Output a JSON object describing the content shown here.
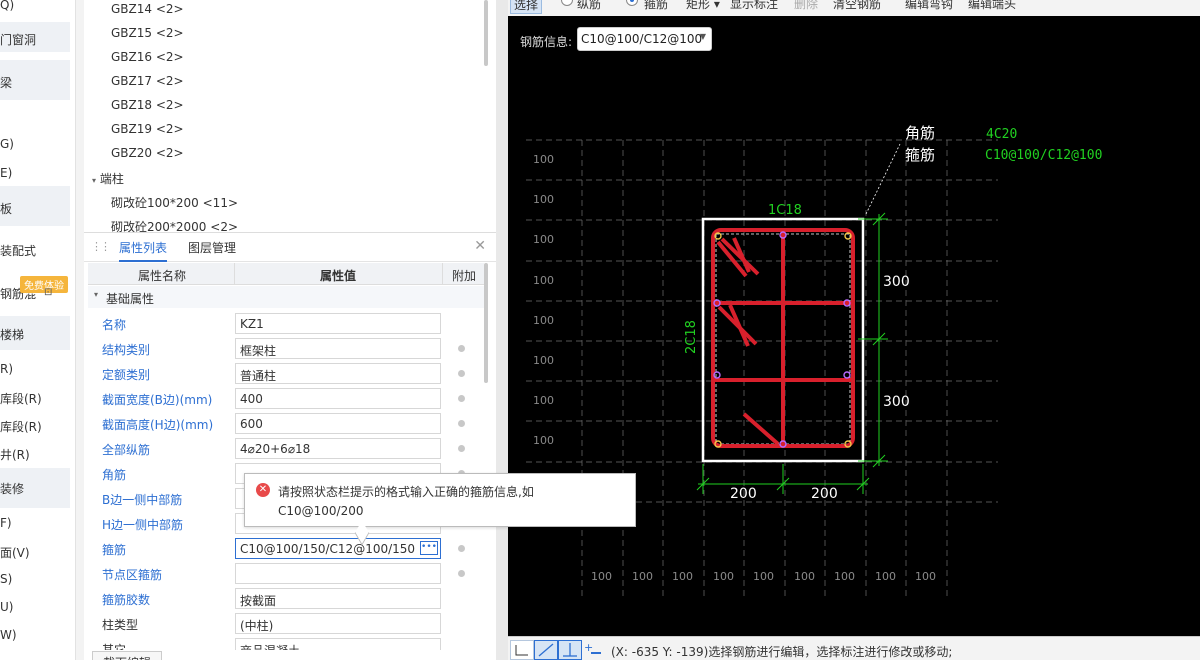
{
  "sidebar": {
    "items": [
      "Q)",
      "门窗洞",
      "梁",
      "G)",
      "E)",
      "板",
      "装配式",
      "钢筋混",
      "楼梯",
      "R)",
      "库段(R)",
      "库段(R)",
      "井(R)",
      "装修",
      "F)",
      "面(V)",
      "S)",
      "U)",
      "W)"
    ],
    "badge": "免费体验"
  },
  "tree": {
    "items": [
      "GBZ14 <2>",
      "GBZ15 <2>",
      "GBZ16 <2>",
      "GBZ17 <2>",
      "GBZ18 <2>",
      "GBZ19 <2>",
      "GBZ20 <2>"
    ],
    "group": "端柱",
    "sub_items": [
      "砌改砼100*200 <11>",
      "砌改砼200*2000 <2>"
    ]
  },
  "prop_panel": {
    "tab_active": "属性列表",
    "tab_other": "图层管理",
    "headers": {
      "name": "属性名称",
      "value": "属性值",
      "extra": "附加"
    },
    "group": "基础属性",
    "rows": [
      {
        "name": "名称",
        "value": "KZ1"
      },
      {
        "name": "结构类别",
        "value": "框架柱"
      },
      {
        "name": "定额类别",
        "value": "普通柱"
      },
      {
        "name": "截面宽度(B边)(mm)",
        "value": "400"
      },
      {
        "name": "截面高度(H边)(mm)",
        "value": "600"
      },
      {
        "name": "全部纵筋",
        "value": "4⌀20+6⌀18"
      },
      {
        "name": "角筋",
        "value": ""
      },
      {
        "name": "B边一侧中部筋",
        "value": ""
      },
      {
        "name": "H边一侧中部筋",
        "value": ""
      },
      {
        "name": "箍筋",
        "value": "C10@100/150/C12@100/150"
      },
      {
        "name": "节点区箍筋",
        "value": ""
      },
      {
        "name": "箍筋胶数",
        "value": "按截面"
      },
      {
        "name": "柱类型",
        "value": "(中柱)"
      },
      {
        "name": "其它",
        "value": "商品混凝土"
      }
    ],
    "bottom_button": "截面编辑"
  },
  "tooltip": {
    "line1": "请按照状态栏提示的格式输入正确的箍筋信息,如",
    "line2": "C10@100/200"
  },
  "toolbar": {
    "items": [
      "选择",
      "纵筋",
      "箍筋",
      "矩形 ▾",
      "显示标注",
      "删除",
      "清空钢筋",
      "编辑弯钩",
      "编辑端头"
    ]
  },
  "cad": {
    "rebar_info_label": "钢筋信息:",
    "rebar_info_value": "C10@100/C12@100",
    "grid_label": "100",
    "callout_corner": "角筋",
    "callout_stirrup": "箍筋",
    "corner_value": "4C20",
    "stirrup_value": "C10@100/C12@100",
    "top_label": "1C18",
    "side_label": "2C18",
    "dim_300": "300",
    "dim_200": "200",
    "colors": {
      "red": "#d8202c",
      "green": "#21d021",
      "white": "#ffffff",
      "grid": "#6f6f6f"
    }
  },
  "status": {
    "text": "(X: -635 Y: -139)选择钢筋进行编辑，选择标注进行修改或移动;"
  }
}
